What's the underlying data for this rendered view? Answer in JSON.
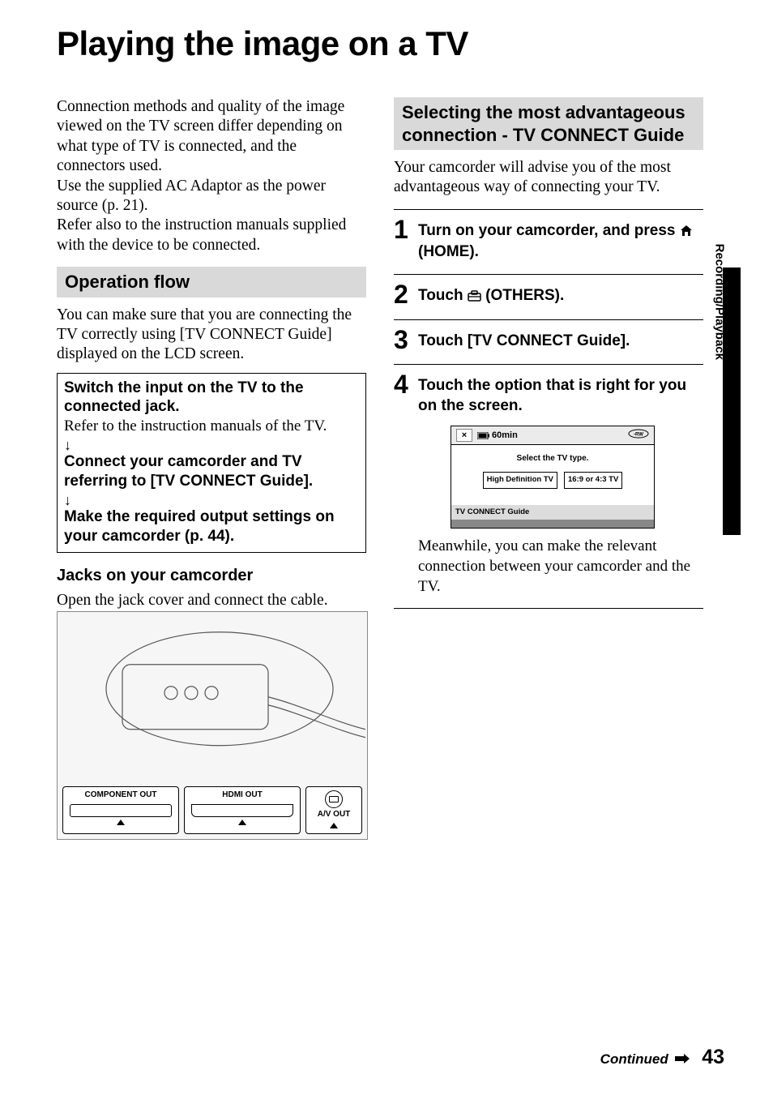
{
  "title": "Playing the image on a TV",
  "side_label": "Recording/Playback",
  "left": {
    "intro": "Connection methods and quality of the image viewed on the TV screen differ depending on what type of TV is connected, and the connectors used.\nUse the supplied AC Adaptor as the power source (p. 21).\nRefer also to the instruction manuals supplied with the device to be connected.",
    "section_head": "Operation flow",
    "after_head": "You can make sure that you are connecting the TV correctly using [TV CONNECT Guide] displayed on the LCD screen.",
    "box": {
      "b1": "Switch the input on the TV to the connected jack.",
      "t1": "Refer to the instruction manuals of the TV.",
      "b2": "Connect your camcorder and TV referring to [TV CONNECT Guide].",
      "b3": "Make the required output settings on your camcorder (p. 44)."
    },
    "subhead": "Jacks on your camcorder",
    "sub_text": "Open the jack cover and connect the cable.",
    "jacks": {
      "comp": "COMPONENT OUT",
      "hdmi": "HDMI OUT",
      "av": "A/V OUT"
    }
  },
  "right": {
    "section_head": "Selecting the most advantageous connection - TV CONNECT Guide",
    "intro": "Your camcorder will advise you of the most advantageous way of connecting your TV.",
    "step1a": "Turn on your camcorder, and press ",
    "step1b": " (HOME).",
    "step2a": "Touch ",
    "step2b": " (OTHERS).",
    "step3": "Touch [TV CONNECT Guide].",
    "step4": "Touch the option that is right for you on the screen.",
    "screen": {
      "batt": "60min",
      "prompt": "Select the TV type.",
      "opt1": "High Definition TV",
      "opt2": "16:9 or 4:3 TV",
      "footer": "TV CONNECT Guide"
    },
    "after4": "Meanwhile, you can make the relevant connection between your camcorder and the TV."
  },
  "footer": {
    "cont": "Continued",
    "pnum": "43"
  }
}
